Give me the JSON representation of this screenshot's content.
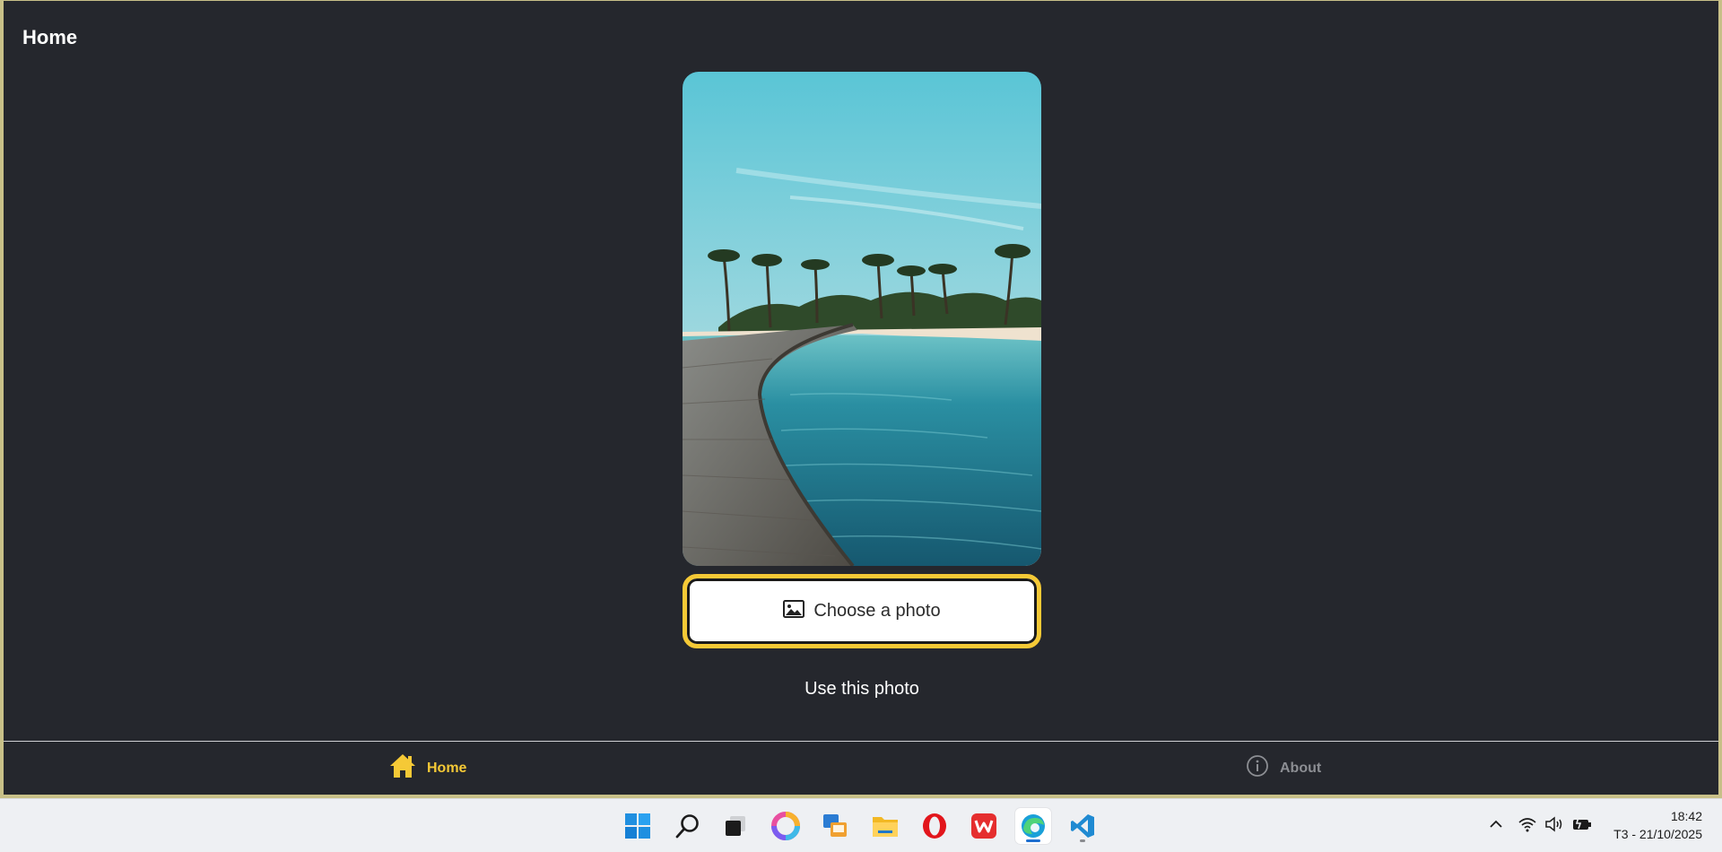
{
  "page": {
    "title": "Home"
  },
  "photo": {
    "subject": "beach-boardwalk-photo"
  },
  "actions": {
    "choose_label": "Choose a photo",
    "use_label": "Use this photo"
  },
  "tabs": [
    {
      "label": "Home",
      "icon": "home-icon",
      "active": true
    },
    {
      "label": "About",
      "icon": "info-icon",
      "active": false
    }
  ],
  "colors": {
    "accent": "#f5c936",
    "background": "#25272d",
    "tab_inactive": "#8c8e93"
  },
  "taskbar": {
    "apps": [
      {
        "name": "start-icon"
      },
      {
        "name": "search-icon"
      },
      {
        "name": "task-view-icon"
      },
      {
        "name": "copilot-icon"
      },
      {
        "name": "remote-desktop-icon"
      },
      {
        "name": "file-explorer-icon"
      },
      {
        "name": "opera-icon"
      },
      {
        "name": "wps-office-icon"
      },
      {
        "name": "edge-icon",
        "active": true
      },
      {
        "name": "vscode-icon",
        "running": true
      }
    ],
    "time": "18:42",
    "date": "T3 - 21/10/2025"
  }
}
